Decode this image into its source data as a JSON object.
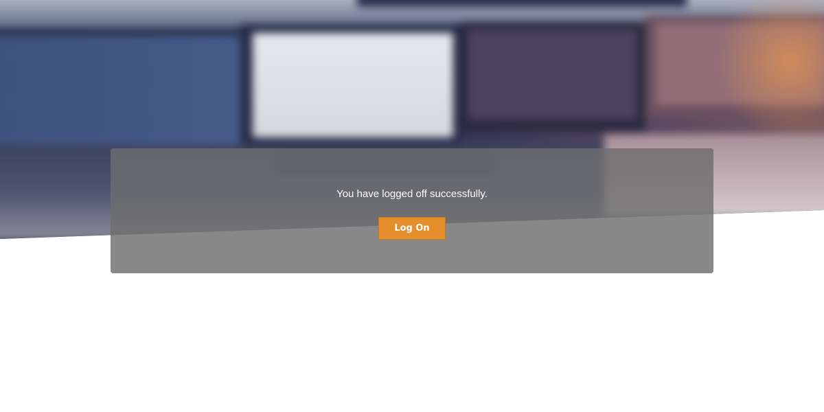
{
  "logoff": {
    "message": "You have logged off successfully.",
    "logon_button_label": "Log On"
  },
  "colors": {
    "button_background": "#e58f2c",
    "panel_background": "#6e6e6e",
    "page_background": "#ffffff"
  },
  "background": {
    "image_subject": "blurred-computer-monitors"
  }
}
